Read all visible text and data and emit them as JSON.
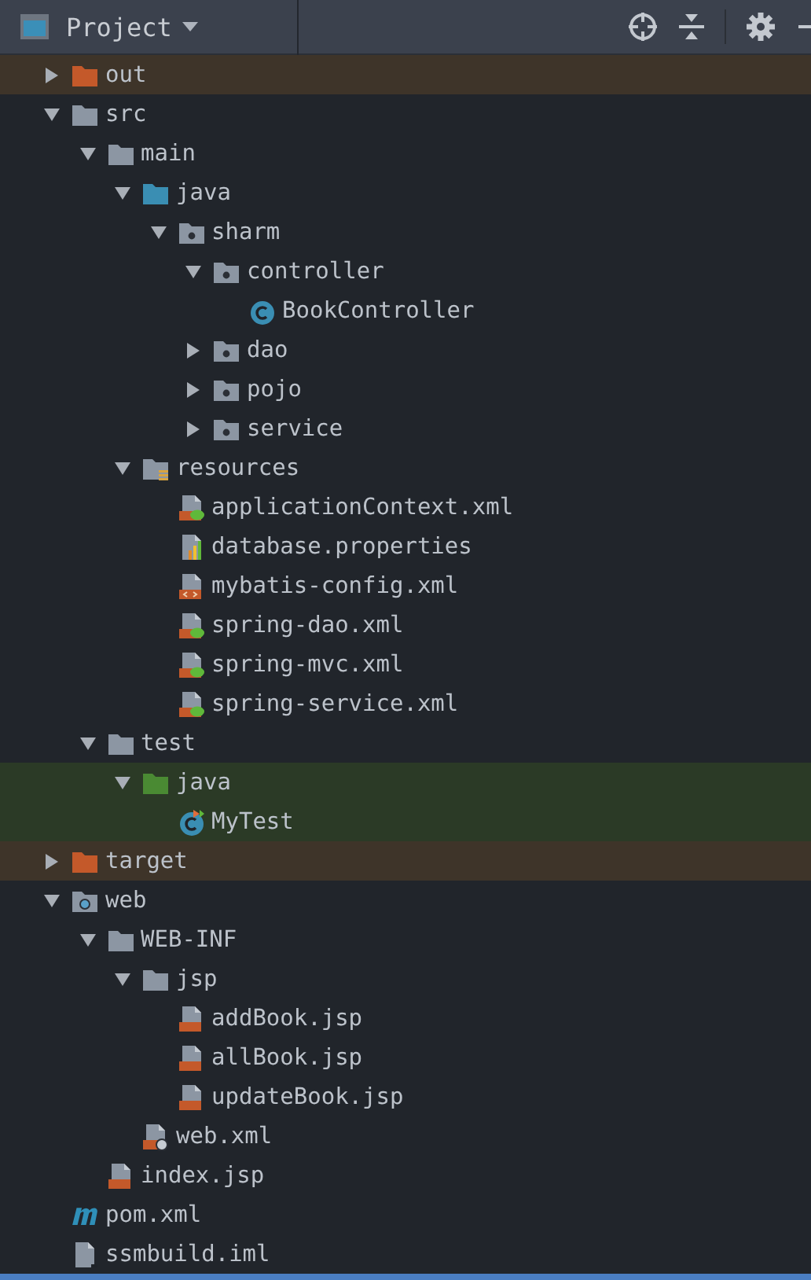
{
  "panel": {
    "title": "Project"
  },
  "tree": [
    {
      "label": "out",
      "kind": "folder-excluded",
      "expanded": false
    },
    {
      "label": "src",
      "kind": "folder",
      "expanded": true,
      "children": [
        {
          "label": "main",
          "kind": "folder",
          "expanded": true,
          "children": [
            {
              "label": "java",
              "kind": "folder-source",
              "expanded": true,
              "children": [
                {
                  "label": "sharm",
                  "kind": "package",
                  "expanded": true,
                  "children": [
                    {
                      "label": "controller",
                      "kind": "package",
                      "expanded": true,
                      "children": [
                        {
                          "label": "BookController",
                          "kind": "java-class"
                        }
                      ]
                    },
                    {
                      "label": "dao",
                      "kind": "package",
                      "expanded": false
                    },
                    {
                      "label": "pojo",
                      "kind": "package",
                      "expanded": false
                    },
                    {
                      "label": "service",
                      "kind": "package",
                      "expanded": false
                    }
                  ]
                }
              ]
            },
            {
              "label": "resources",
              "kind": "folder-resources",
              "expanded": true,
              "children": [
                {
                  "label": "applicationContext.xml",
                  "kind": "spring-xml"
                },
                {
                  "label": "database.properties",
                  "kind": "properties"
                },
                {
                  "label": "mybatis-config.xml",
                  "kind": "xml"
                },
                {
                  "label": "spring-dao.xml",
                  "kind": "spring-xml"
                },
                {
                  "label": "spring-mvc.xml",
                  "kind": "spring-xml"
                },
                {
                  "label": "spring-service.xml",
                  "kind": "spring-xml"
                }
              ]
            }
          ]
        },
        {
          "label": "test",
          "kind": "folder",
          "expanded": true,
          "children": [
            {
              "label": "java",
              "kind": "folder-test",
              "expanded": true,
              "children": [
                {
                  "label": "MyTest",
                  "kind": "java-test"
                }
              ]
            }
          ]
        }
      ]
    },
    {
      "label": "target",
      "kind": "folder-excluded",
      "expanded": false
    },
    {
      "label": "web",
      "kind": "folder-web",
      "expanded": true,
      "children": [
        {
          "label": "WEB-INF",
          "kind": "folder",
          "expanded": true,
          "children": [
            {
              "label": "jsp",
              "kind": "folder",
              "expanded": true,
              "children": [
                {
                  "label": "addBook.jsp",
                  "kind": "jsp"
                },
                {
                  "label": "allBook.jsp",
                  "kind": "jsp"
                },
                {
                  "label": "updateBook.jsp",
                  "kind": "jsp"
                }
              ]
            },
            {
              "label": "web.xml",
              "kind": "web-xml"
            }
          ]
        },
        {
          "label": "index.jsp",
          "kind": "jsp"
        }
      ]
    },
    {
      "label": "pom.xml",
      "kind": "maven"
    },
    {
      "label": "ssmbuild.iml",
      "kind": "iml"
    }
  ]
}
